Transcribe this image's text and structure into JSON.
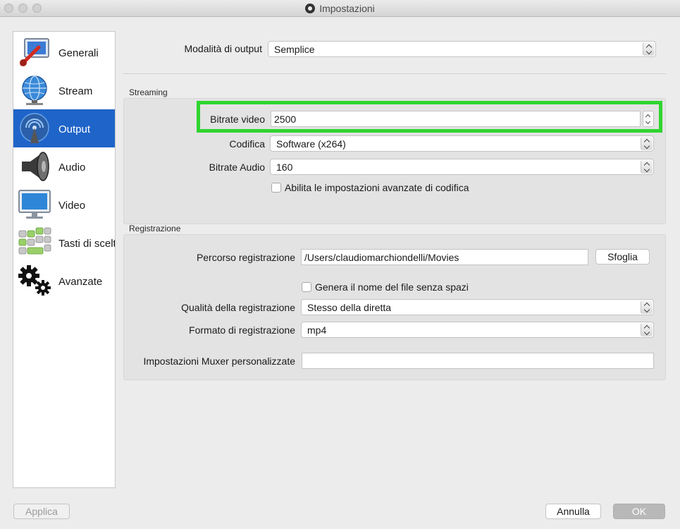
{
  "window": {
    "title": "Impostazioni"
  },
  "sidebar": {
    "items": [
      {
        "label": "Generali",
        "icon": "general-settings-icon"
      },
      {
        "label": "Stream",
        "icon": "stream-globe-icon"
      },
      {
        "label": "Output",
        "icon": "output-broadcast-icon"
      },
      {
        "label": "Audio",
        "icon": "speaker-icon"
      },
      {
        "label": "Video",
        "icon": "monitor-icon"
      },
      {
        "label": "Tasti di scelta rapida",
        "icon": "hotkeys-icon"
      },
      {
        "label": "Avanzate",
        "icon": "gears-icon"
      }
    ],
    "active": "Output"
  },
  "output_mode": {
    "label": "Modalità di output",
    "value": "Semplice"
  },
  "streaming": {
    "title": "Streaming",
    "video_bitrate": {
      "label": "Bitrate video",
      "value": "2500"
    },
    "encoder": {
      "label": "Codifica",
      "value": "Software (x264)"
    },
    "audio_bitrate": {
      "label": "Bitrate Audio",
      "value": "160"
    },
    "advanced_encoder": {
      "label": "Abilita le impostazioni avanzate di codifica",
      "checked": false
    }
  },
  "recording": {
    "title": "Registrazione",
    "path": {
      "label": "Percorso registrazione",
      "value": "/Users/claudiomarchiondelli/Movies",
      "browse_label": "Sfoglia"
    },
    "no_spaces": {
      "label": "Genera il nome del file senza spazi",
      "checked": false
    },
    "quality": {
      "label": "Qualità della registrazione",
      "value": "Stesso della diretta"
    },
    "format": {
      "label": "Formato di registrazione",
      "value": "mp4"
    },
    "muxer": {
      "label": "Impostazioni Muxer personalizzate",
      "value": ""
    }
  },
  "footer": {
    "apply_label": "Applica",
    "cancel_label": "Annulla",
    "ok_label": "OK"
  },
  "colors": {
    "selection": "#1f64c9",
    "highlight_border": "#2fd52f"
  }
}
